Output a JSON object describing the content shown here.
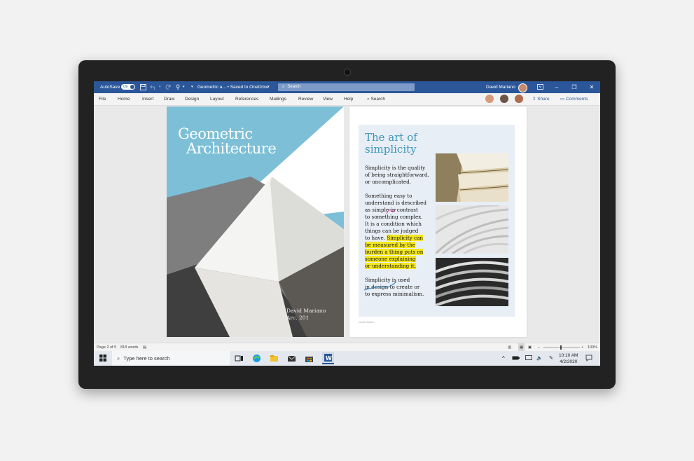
{
  "titlebar": {
    "autosave_label": "AutoSave",
    "autosave_state": "On",
    "document_title": "Geometric a... • Saved to OneDrive",
    "search_placeholder": "Search",
    "user_name": "David Mariano"
  },
  "ribbon": {
    "tabs": [
      "File",
      "Home",
      "Insert",
      "Draw",
      "Design",
      "Layout",
      "References",
      "Mailings",
      "Review",
      "View",
      "Help"
    ],
    "search_label": "Search",
    "share_label": "Share",
    "comments_label": "Comments"
  },
  "cover": {
    "title_line1": "Geometric",
    "title_line2": "Architecture",
    "author": "David Mariano",
    "course": "Arc. 201"
  },
  "article": {
    "title_line1": "The art of",
    "title_line2": "simplicity",
    "para1": [
      "Simplicity is the quality",
      "of being straightforward,",
      "or uncomplicated."
    ],
    "para2": [
      "Something easy to",
      "understand is described",
      "as simple in contrast",
      "to something complex.",
      "It is a condition which",
      "things can be judged",
      "to have."
    ],
    "para2_highlight_start": "Simplicity can",
    "para2_highlight": [
      "be measured by the",
      "burden a thing puts on",
      "someone explaining",
      "or understanding it."
    ],
    "para3": [
      "Simplicity is used",
      "in design to create or",
      "to express minimalism."
    ],
    "footer": "David Mariano"
  },
  "status": {
    "page_info": "Page 2 of 5",
    "word_count": "818 words",
    "zoom": "100%"
  },
  "taskbar": {
    "search_placeholder": "Type here to search",
    "time": "10:10 AM",
    "date": "4/2/2020"
  },
  "colors": {
    "word_blue": "#2b579a",
    "cover_sky": "#7cbfd6",
    "title_teal": "#3a95b8",
    "highlight": "#f4e720"
  }
}
